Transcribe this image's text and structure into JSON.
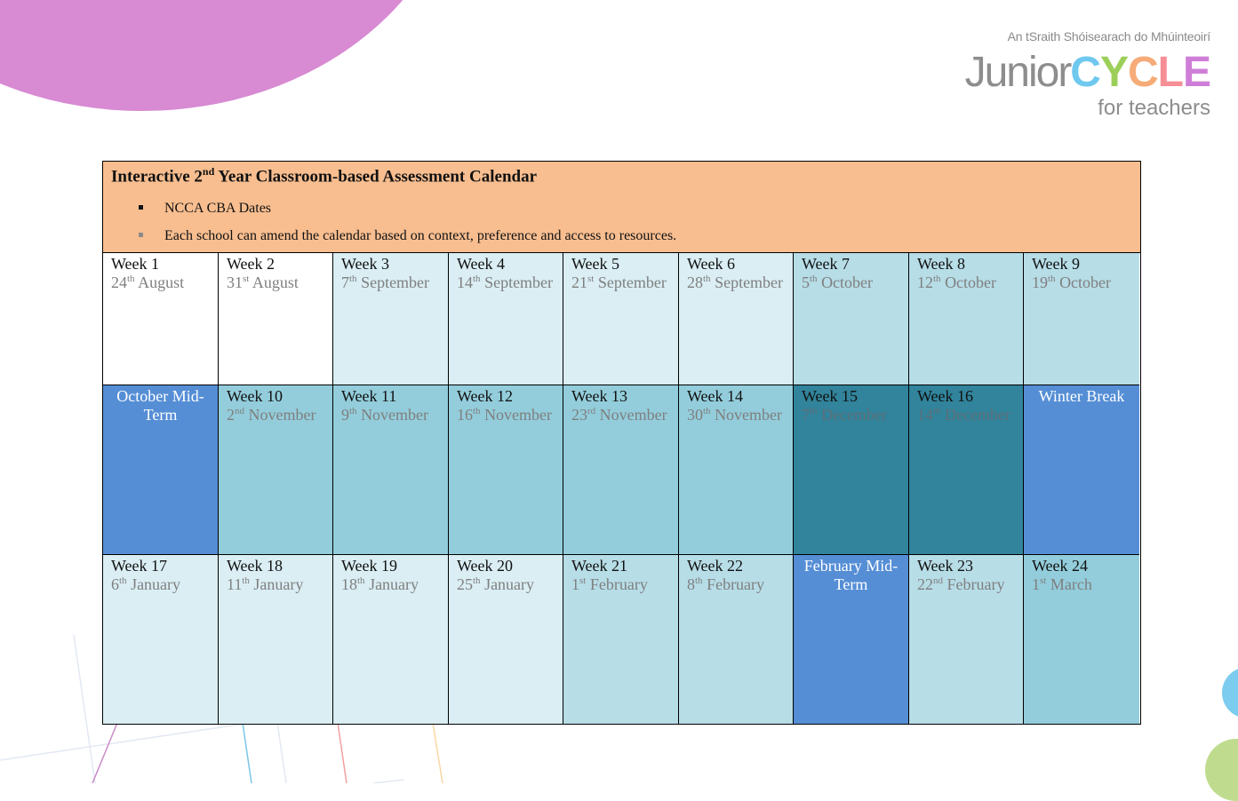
{
  "logo": {
    "irish_line": "An tSraith Shóisearach do Mhúinteoirí",
    "junior": "Junior",
    "cycle_letters": [
      {
        "char": "C",
        "color": "#6fc8ee"
      },
      {
        "char": "Y",
        "color": "#9ccf5a"
      },
      {
        "char": "C",
        "color": "#f6ab78"
      },
      {
        "char": "L",
        "color": "#f58e95"
      },
      {
        "char": "E",
        "color": "#cf7ed8"
      }
    ],
    "subtitle": "for teachers"
  },
  "header": {
    "title_prefix": "Interactive 2",
    "title_sup": "nd",
    "title_suffix": " Year Classroom-based Assessment Calendar",
    "background": "#f8be90",
    "bullets": [
      {
        "text": "NCCA CBA Dates",
        "marker_color": "#111111"
      },
      {
        "text": "Each school can amend the calendar based on context, preference and access to resources.",
        "marker_color": "#8a8a8a"
      }
    ]
  },
  "colors": {
    "white": "#ffffff",
    "pale": "#daeef4",
    "light": "#b7dde7",
    "mid": "#93cddb",
    "dark": "#31849b",
    "break": "#558ed5"
  },
  "rows": [
    [
      {
        "type": "week",
        "week": "Week 1",
        "day": "24",
        "suffix": "th",
        "month": " August",
        "shade": "white"
      },
      {
        "type": "week",
        "week": "Week 2",
        "day": "31",
        "suffix": "st",
        "month": " August",
        "shade": "white"
      },
      {
        "type": "week",
        "week": "Week 3",
        "day": "7",
        "suffix": "th",
        "month": " September",
        "shade": "pale"
      },
      {
        "type": "week",
        "week": "Week 4",
        "day": "14",
        "suffix": "th",
        "month": " September",
        "shade": "pale"
      },
      {
        "type": "week",
        "week": "Week 5",
        "day": "21",
        "suffix": "st",
        "month": " September",
        "shade": "pale"
      },
      {
        "type": "week",
        "week": "Week 6",
        "day": "28",
        "suffix": "th",
        "month": " September",
        "shade": "pale"
      },
      {
        "type": "week",
        "week": "Week 7",
        "day": "5",
        "suffix": "th",
        "month": " October",
        "shade": "light"
      },
      {
        "type": "week",
        "week": "Week 8",
        "day": "12",
        "suffix": "th",
        "month": " October",
        "shade": "light"
      },
      {
        "type": "week",
        "week": "Week 9",
        "day": "19",
        "suffix": "th",
        "month": " October",
        "shade": "light"
      }
    ],
    [
      {
        "type": "break",
        "label": "October Mid-Term",
        "shade": "break"
      },
      {
        "type": "week",
        "week": "Week 10",
        "day": "2",
        "suffix": "nd",
        "month": " November",
        "shade": "mid"
      },
      {
        "type": "week",
        "week": "Week 11",
        "day": "9",
        "suffix": "th",
        "month": " November",
        "shade": "mid"
      },
      {
        "type": "week",
        "week": "Week 12",
        "day": "16",
        "suffix": "th",
        "month": " November",
        "shade": "mid"
      },
      {
        "type": "week",
        "week": "Week 13",
        "day": "23",
        "suffix": "rd",
        "month": " November",
        "shade": "mid"
      },
      {
        "type": "week",
        "week": "Week 14",
        "day": "30",
        "suffix": "th",
        "month": " November",
        "shade": "mid"
      },
      {
        "type": "week",
        "week": "Week 15",
        "day": "7",
        "suffix": "th",
        "month": " December",
        "shade": "dark"
      },
      {
        "type": "week",
        "week": "Week 16",
        "day": "14",
        "suffix": "th",
        "month": " December",
        "shade": "dark"
      },
      {
        "type": "break",
        "label": "Winter Break",
        "shade": "break"
      }
    ],
    [
      {
        "type": "week",
        "week": "Week 17",
        "day": "6",
        "suffix": "th",
        "month": " January",
        "shade": "pale"
      },
      {
        "type": "week",
        "week": "Week 18",
        "day": "11",
        "suffix": "th",
        "month": " January",
        "shade": "pale"
      },
      {
        "type": "week",
        "week": "Week 19",
        "day": "18",
        "suffix": "th",
        "month": " January",
        "shade": "pale"
      },
      {
        "type": "week",
        "week": "Week 20",
        "day": "25",
        "suffix": "th",
        "month": " January",
        "shade": "pale"
      },
      {
        "type": "week",
        "week": "Week 21",
        "day": "1",
        "suffix": "st",
        "month": " February",
        "shade": "light"
      },
      {
        "type": "week",
        "week": "Week 22",
        "day": "8",
        "suffix": "th",
        "month": " February",
        "shade": "light"
      },
      {
        "type": "break",
        "label": "February Mid-Term",
        "shade": "break"
      },
      {
        "type": "week",
        "week": "Week 23",
        "day": "22",
        "suffix": "nd",
        "month": " February",
        "shade": "light"
      },
      {
        "type": "week",
        "week": "Week 24",
        "day": "1",
        "suffix": "st",
        "month": " March",
        "shade": "mid"
      }
    ]
  ]
}
